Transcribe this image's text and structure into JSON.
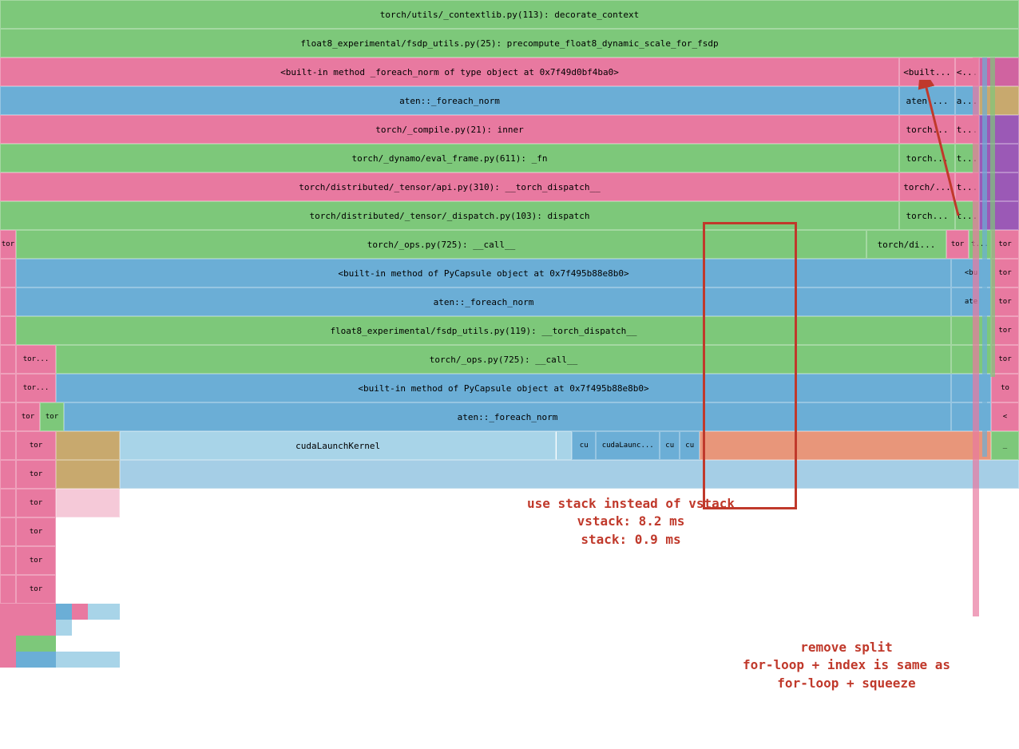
{
  "colors": {
    "pink": "#e879a0",
    "green": "#7dc87a",
    "blue": "#6baed6",
    "tan": "#c8a96e",
    "lightblue": "#a8d4e8",
    "darkpink": "#d63384",
    "olive": "#8fb04a",
    "purple": "#9b59b6",
    "salmon": "#e8967a",
    "teal": "#5ba8a0",
    "annotation_red": "#c0392b",
    "annotation_blue": "#2980b9"
  },
  "rows": [
    {
      "id": "row0",
      "cells": [
        {
          "text": "torch/utils/_contextlib.py(113): decorate_context",
          "color": "#7dc87a",
          "flex": 1
        }
      ]
    },
    {
      "id": "row1",
      "cells": [
        {
          "text": "float8_experimental/fsdp_utils.py(25): precompute_float8_dynamic_scale_for_fsdp",
          "color": "#7dc87a",
          "flex": 1
        }
      ]
    },
    {
      "id": "row2",
      "cells": [
        {
          "text": "<built-in method _foreach_norm of type object at 0x7f49d0bf4ba0>",
          "color": "#e879a0",
          "flex": 10
        },
        {
          "text": "<built...",
          "color": "#e879a0",
          "flex": 1
        },
        {
          "text": "<...",
          "color": "#e879a0",
          "flex": 0.5
        },
        {
          "text": "",
          "color": "#9b59b6",
          "flex": 0.5
        }
      ]
    },
    {
      "id": "row3",
      "cells": [
        {
          "text": "aten::_foreach_norm",
          "color": "#6baed6",
          "flex": 10
        },
        {
          "text": "aten:...",
          "color": "#6baed6",
          "flex": 1
        },
        {
          "text": "a...",
          "color": "#6baed6",
          "flex": 0.5
        },
        {
          "text": "",
          "color": "#c8a96e",
          "flex": 0.5
        }
      ]
    },
    {
      "id": "row4",
      "cells": [
        {
          "text": "torch/_compile.py(21): inner",
          "color": "#e879a0",
          "flex": 10
        },
        {
          "text": "torch...",
          "color": "#e879a0",
          "flex": 1
        },
        {
          "text": "t...",
          "color": "#e879a0",
          "flex": 0.5
        },
        {
          "text": "",
          "color": "#9b59b6",
          "flex": 0.5
        }
      ]
    },
    {
      "id": "row5",
      "cells": [
        {
          "text": "torch/_dynamo/eval_frame.py(611): _fn",
          "color": "#7dc87a",
          "flex": 10
        },
        {
          "text": "torch...",
          "color": "#7dc87a",
          "flex": 1
        },
        {
          "text": "t...",
          "color": "#7dc87a",
          "flex": 0.5
        },
        {
          "text": "",
          "color": "#9b59b6",
          "flex": 0.5
        }
      ]
    },
    {
      "id": "row6",
      "cells": [
        {
          "text": "torch/distributed/_tensor/api.py(310): __torch_dispatch__",
          "color": "#e879a0",
          "flex": 10
        },
        {
          "text": "torch/...",
          "color": "#e879a0",
          "flex": 1
        },
        {
          "text": "t...",
          "color": "#e879a0",
          "flex": 0.5
        },
        {
          "text": "",
          "color": "#9b59b6",
          "flex": 0.5
        }
      ]
    },
    {
      "id": "row7",
      "cells": [
        {
          "text": "torch/distributed/_tensor/_dispatch.py(103): dispatch",
          "color": "#7dc87a",
          "flex": 10
        },
        {
          "text": "torch...",
          "color": "#7dc87a",
          "flex": 1
        },
        {
          "text": "t...",
          "color": "#7dc87a",
          "flex": 0.5
        },
        {
          "text": "",
          "color": "#9b59b6",
          "flex": 0.5
        }
      ]
    }
  ],
  "annotations": {
    "box": {
      "label": "highlighted region"
    },
    "use_stack": {
      "line1": "use stack instead of vstack",
      "line2": "vstack: 8.2 ms",
      "line3": "stack: 0.9 ms"
    },
    "remove_split": {
      "line1": "remove split",
      "line2": "for-loop + index is same as",
      "line3": "for-loop + squeeze"
    }
  },
  "small_labels": {
    "tor": "tor",
    "ate": "ate",
    "bu": "<bu",
    "torch_di": "torch/di...",
    "t": "t...",
    "to": "to",
    "lt": "<",
    "dash": "_",
    "tor_dots": "tor...",
    "cu": "cu",
    "cudaLaunchKernel": "cudaLaunchKernel",
    "cudaLaunc": "cudaLaunc..."
  }
}
